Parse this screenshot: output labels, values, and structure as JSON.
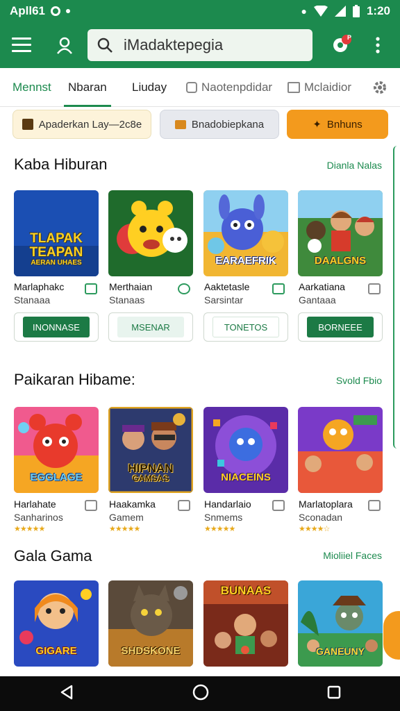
{
  "status_bar": {
    "left_text": "Apll61",
    "time": "1:20"
  },
  "search": {
    "value": "iMadaktepegia",
    "notification_badge": "P"
  },
  "tabs": [
    {
      "label": "Mennst"
    },
    {
      "label": "Nbaran"
    },
    {
      "label": "Liuday"
    },
    {
      "label": "Naotenpdidar"
    },
    {
      "label": "Mclaidior"
    }
  ],
  "chips": [
    {
      "label": "Apaderkan Lay—2c8e"
    },
    {
      "label": "Bnadobiepkana"
    },
    {
      "label": "Bnhuns"
    }
  ],
  "sections": [
    {
      "title": "Kaba Hiburan",
      "link": "Dianla Nalas",
      "apps": [
        {
          "tile_text": "TLAPAK TEAPAN",
          "tile_sub": "AERAN UHAES",
          "name": "Marlaphakc",
          "sub": "Stanaaa",
          "button": "INONNASE",
          "button_style": "solid"
        },
        {
          "tile_text": "",
          "tile_sub": "",
          "name": "Merthaian",
          "sub": "Stanaas",
          "button": "MSENAR",
          "button_style": "light"
        },
        {
          "tile_text": "EARAEFRIK",
          "tile_sub": "",
          "name": "Aaktetasle",
          "sub": "Sarsintar",
          "button": "TONETOS",
          "button_style": "white"
        },
        {
          "tile_text": "DAALGNS",
          "tile_sub": "",
          "name": "Aarkatiana",
          "sub": "Gantaaa",
          "button": "BORNEEE",
          "button_style": "solid"
        }
      ]
    },
    {
      "title": "Paikaran Hibame:",
      "link": "Svold Fbio",
      "apps": [
        {
          "tile_text": "EGGLAGE",
          "tile_sub": "",
          "name": "Harlahate",
          "sub": "Sanharinos",
          "rating": "★★★★★"
        },
        {
          "tile_text": "HIPNAN",
          "tile_sub": "GAMSAS",
          "name": "Haakamka",
          "sub": "Gamem",
          "rating": "★★★★★"
        },
        {
          "tile_text": "NIACEINS",
          "tile_sub": "",
          "name": "Handarlaio",
          "sub": "Snmems",
          "rating": "★★★★★"
        },
        {
          "tile_text": "",
          "tile_sub": "",
          "name": "Marlatoplara",
          "sub": "Sconadan",
          "rating": "★★★★☆"
        }
      ]
    },
    {
      "title": "Gala Gama",
      "link": "Mioliiel Faces",
      "apps": [
        {
          "tile_text": "GIGARE",
          "tile_sub": ""
        },
        {
          "tile_text": "SHDSKONE",
          "tile_sub": ""
        },
        {
          "tile_text": "BUNAAS",
          "tile_sub": ""
        },
        {
          "tile_text": "GANEUNY",
          "tile_sub": ""
        }
      ]
    }
  ],
  "colors": {
    "brand_green": "#1c8a4e",
    "accent_orange": "#f39a1d",
    "star": "#e8a91a"
  }
}
